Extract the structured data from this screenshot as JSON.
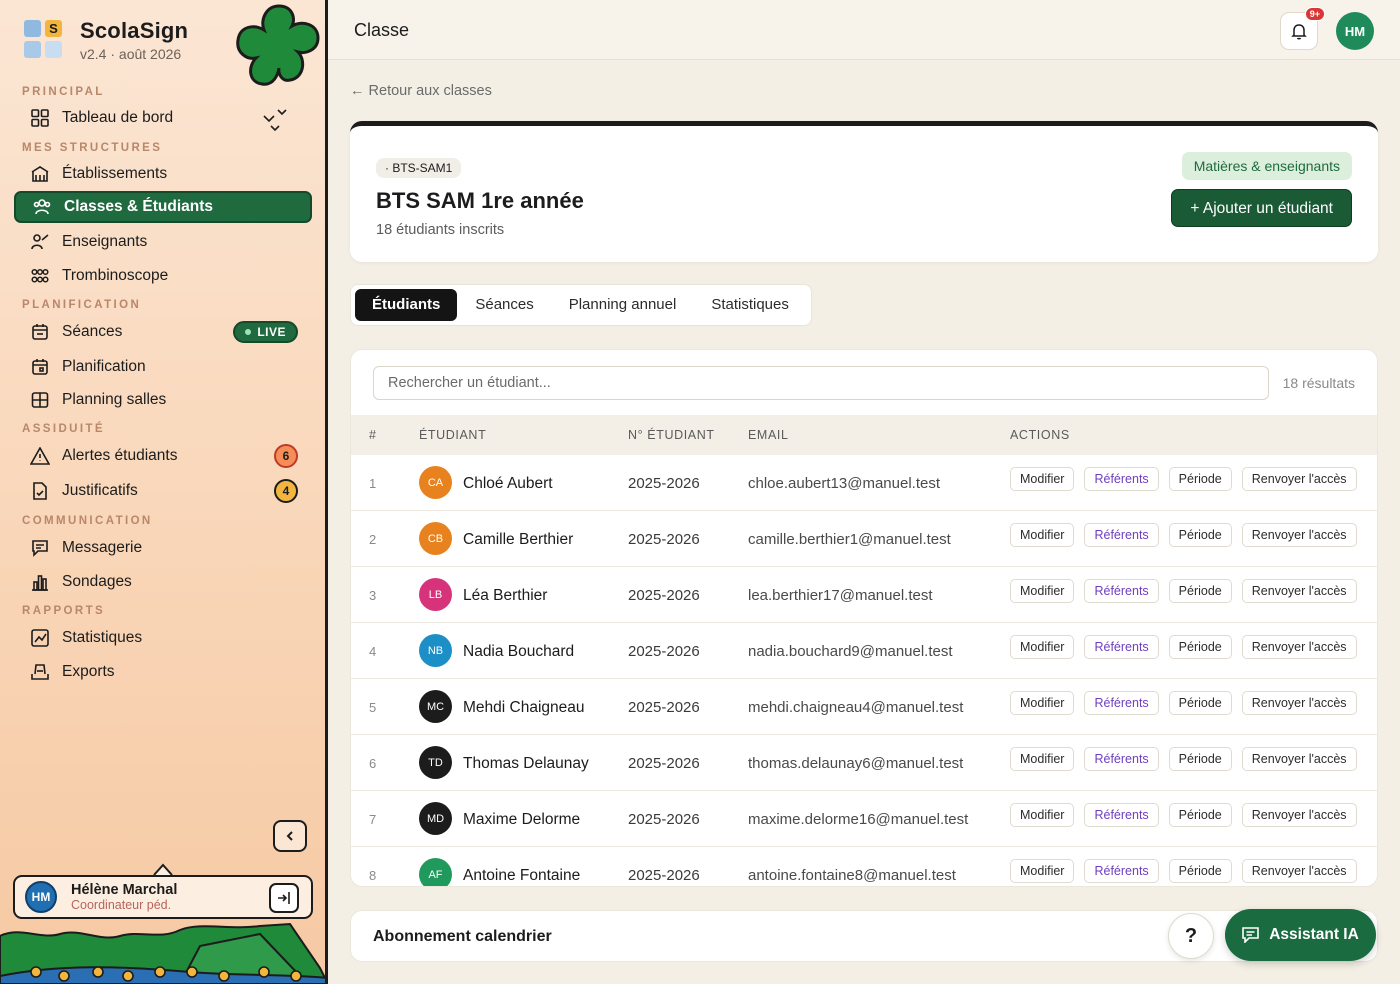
{
  "brand": {
    "name": "ScolaSign",
    "version": "v2.4 · août 2026",
    "logo_letter": "S"
  },
  "sidebar": {
    "sections": {
      "principal": "PRINCIPAL",
      "structures": "MES STRUCTURES",
      "planification": "PLANIFICATION",
      "assiduite": "ASSIDUITÉ",
      "communication": "COMMUNICATION",
      "rapports": "RAPPORTS"
    },
    "items": {
      "dashboard": "Tableau de bord",
      "etablissements": "Établissements",
      "classes": "Classes & Étudiants",
      "enseignants": "Enseignants",
      "trombinoscope": "Trombinoscope",
      "seances": "Séances",
      "planification": "Planification",
      "planning_salles": "Planning salles",
      "alertes": "Alertes étudiants",
      "justificatifs": "Justificatifs",
      "messagerie": "Messagerie",
      "sondages": "Sondages",
      "statistiques": "Statistiques",
      "exports": "Exports"
    },
    "badges": {
      "live": "LIVE",
      "alertes": "6",
      "justificatifs": "4"
    },
    "user": {
      "initials": "HM",
      "name": "Hélène Marchal",
      "role": "Coordinateur péd."
    }
  },
  "topbar": {
    "title": "Classe",
    "notifications_badge": "9+",
    "avatar_initials": "HM"
  },
  "back_link": "← Retour aux classes",
  "class": {
    "code": "· BTS-SAM1",
    "name": "BTS SAM 1re année",
    "subtitle": "18 étudiants inscrits",
    "subjects_button": "Matières & enseignants",
    "add_button": "+ Ajouter un étudiant"
  },
  "tabs": [
    "Étudiants",
    "Séances",
    "Planning annuel",
    "Statistiques"
  ],
  "table": {
    "search_placeholder": "Rechercher un étudiant...",
    "results": "18 résultats",
    "headers": {
      "num": "#",
      "student": "ÉTUDIANT",
      "id": "N° ÉTUDIANT",
      "email": "EMAIL",
      "actions": "ACTIONS"
    },
    "actions": {
      "edit": "Modifier",
      "referents": "Référents",
      "period": "Période",
      "resend": "Renvoyer l'accès"
    },
    "rows": [
      {
        "num": "1",
        "initials": "CA",
        "name": "Chloé Aubert",
        "student_id": "2025-2026",
        "email": "chloe.aubert13@manuel.test",
        "color": "#e8821e"
      },
      {
        "num": "2",
        "initials": "CB",
        "name": "Camille Berthier",
        "student_id": "2025-2026",
        "email": "camille.berthier1@manuel.test",
        "color": "#e8821e"
      },
      {
        "num": "3",
        "initials": "LB",
        "name": "Léa Berthier",
        "student_id": "2025-2026",
        "email": "lea.berthier17@manuel.test",
        "color": "#d6337a"
      },
      {
        "num": "4",
        "initials": "NB",
        "name": "Nadia Bouchard",
        "student_id": "2025-2026",
        "email": "nadia.bouchard9@manuel.test",
        "color": "#1d8fc7"
      },
      {
        "num": "5",
        "initials": "MC",
        "name": "Mehdi Chaigneau",
        "student_id": "2025-2026",
        "email": "mehdi.chaigneau4@manuel.test",
        "color": "#1c1c1c"
      },
      {
        "num": "6",
        "initials": "TD",
        "name": "Thomas Delaunay",
        "student_id": "2025-2026",
        "email": "thomas.delaunay6@manuel.test",
        "color": "#1c1c1c"
      },
      {
        "num": "7",
        "initials": "MD",
        "name": "Maxime Delorme",
        "student_id": "2025-2026",
        "email": "maxime.delorme16@manuel.test",
        "color": "#1c1c1c"
      },
      {
        "num": "8",
        "initials": "AF",
        "name": "Antoine Fontaine",
        "student_id": "2025-2026",
        "email": "antoine.fontaine8@manuel.test",
        "color": "#1f9a5c"
      }
    ]
  },
  "calendar": {
    "title": "Abonnement calendrier"
  },
  "help_label": "?",
  "assistant_label": "Assistant IA"
}
